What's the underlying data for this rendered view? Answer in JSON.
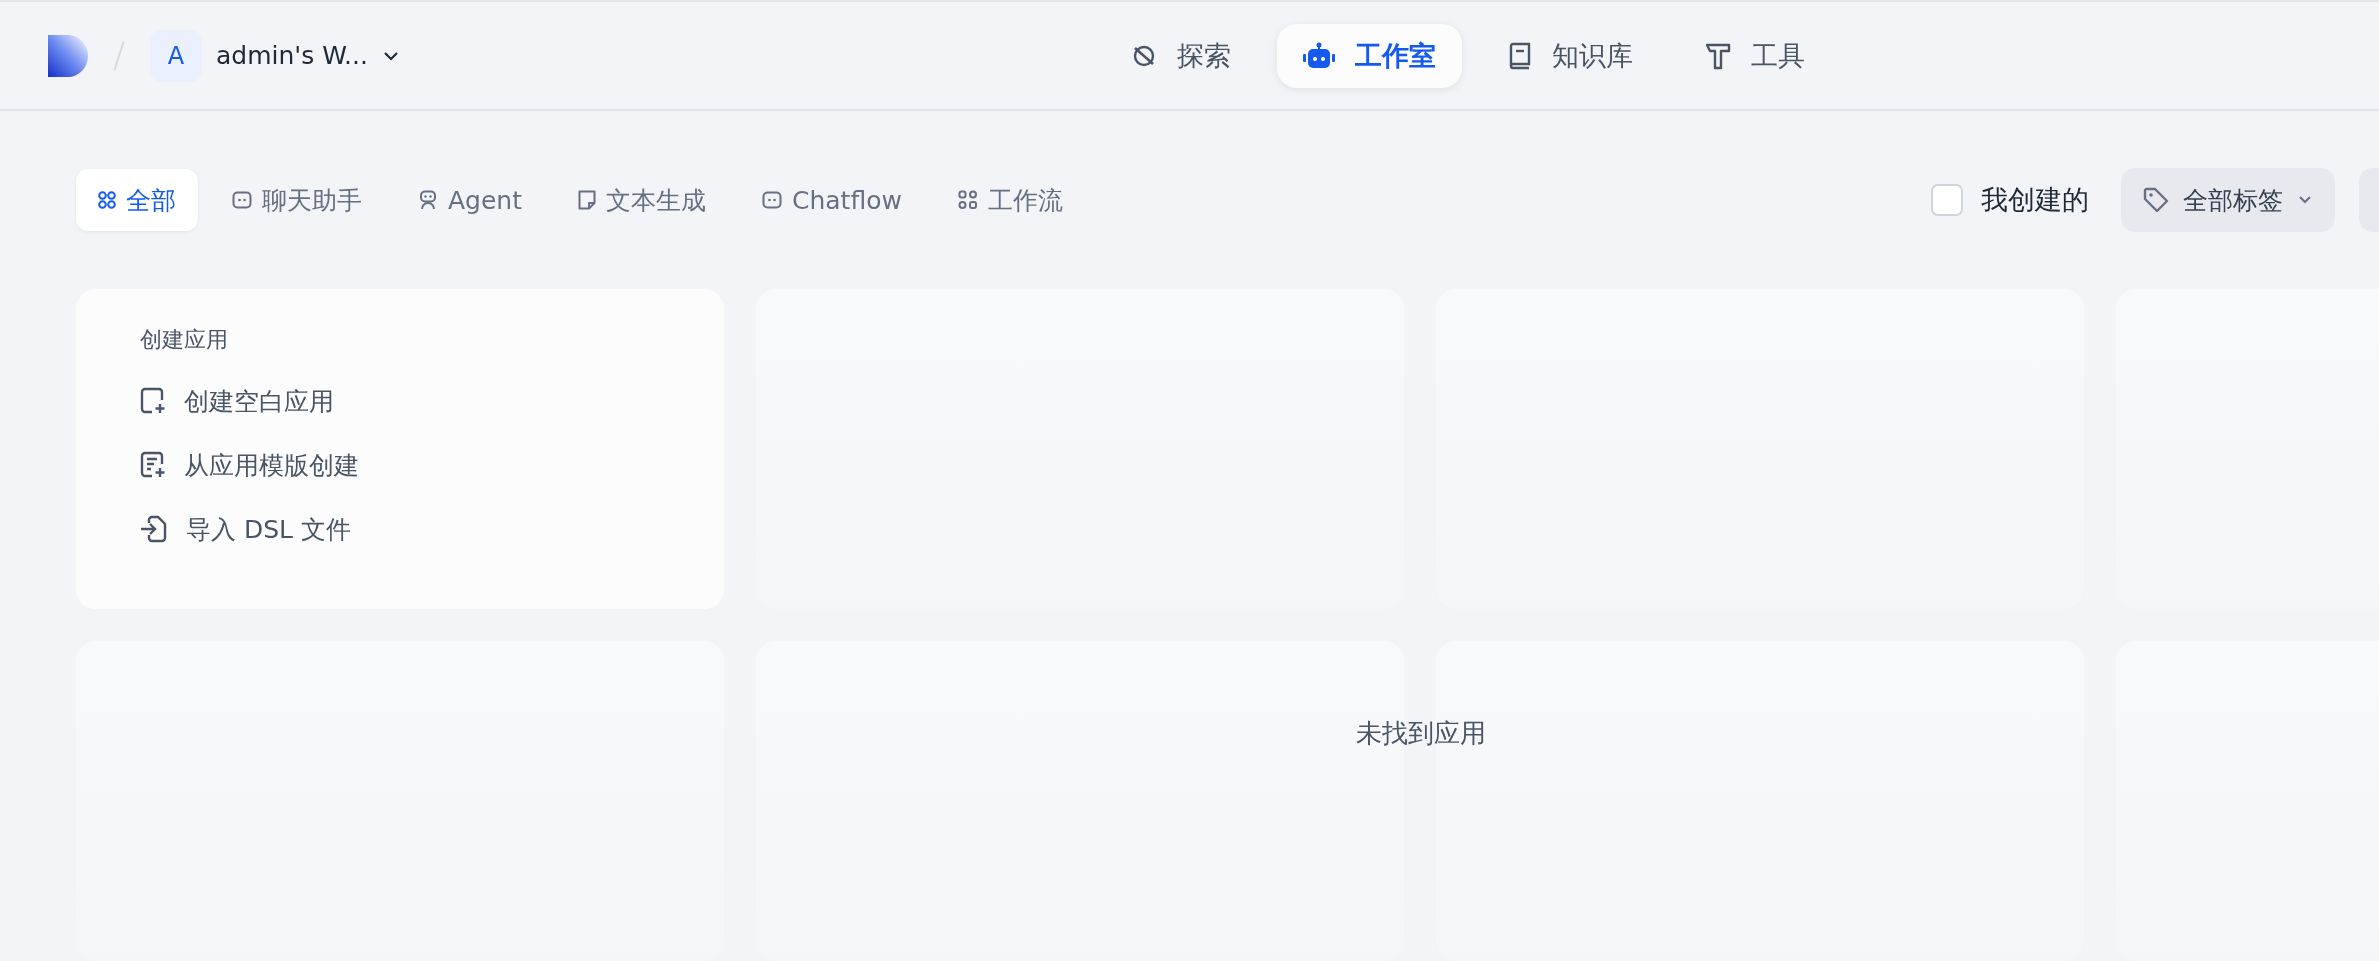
{
  "workspace": {
    "avatar": "A",
    "name": "admin's W..."
  },
  "nav": [
    {
      "label": "探索",
      "kind": "explore",
      "selected": false
    },
    {
      "label": "工作室",
      "kind": "studio",
      "selected": true
    },
    {
      "label": "知识库",
      "kind": "knowledge",
      "selected": false
    },
    {
      "label": "工具",
      "kind": "tools",
      "selected": false
    }
  ],
  "filters": [
    {
      "label": "全部",
      "kind": "all",
      "selected": true
    },
    {
      "label": "聊天助手",
      "kind": "chat",
      "selected": false
    },
    {
      "label": "Agent",
      "kind": "agent",
      "selected": false
    },
    {
      "label": "文本生成",
      "kind": "text",
      "selected": false
    },
    {
      "label": "Chatflow",
      "kind": "chat",
      "selected": false
    },
    {
      "label": "工作流",
      "kind": "workflow",
      "selected": false
    }
  ],
  "mine_checkbox": {
    "label": "我创建的",
    "checked": false
  },
  "tag_filter": {
    "label": "全部标签"
  },
  "create_card": {
    "title": "创建应用",
    "options": [
      {
        "label": "创建空白应用",
        "kind": "blank"
      },
      {
        "label": "从应用模版创建",
        "kind": "template"
      },
      {
        "label": "导入 DSL 文件",
        "kind": "import"
      }
    ]
  },
  "empty_message": "未找到应用"
}
